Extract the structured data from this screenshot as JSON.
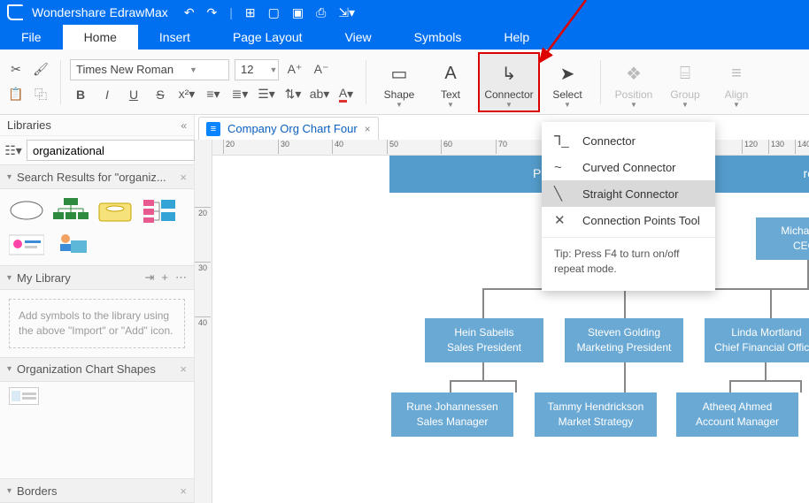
{
  "app": {
    "title": "Wondershare EdrawMax"
  },
  "menu": {
    "file": "File",
    "home": "Home",
    "insert": "Insert",
    "page_layout": "Page Layout",
    "view": "View",
    "symbols": "Symbols",
    "help": "Help"
  },
  "ribbon": {
    "font": "Times New Roman",
    "size": "12",
    "shape": "Shape",
    "text": "Text",
    "connector": "Connector",
    "select": "Select",
    "position": "Position",
    "group": "Group",
    "align": "Align"
  },
  "sidebar": {
    "title": "Libraries",
    "search_value": "organizational",
    "panel_results": "Search Results for  \"organiz...",
    "panel_mylib": "My Library",
    "hint": "Add symbols to the library using the above \"Import\" or \"Add\" icon.",
    "panel_org": "Organization Chart Shapes",
    "panel_borders": "Borders"
  },
  "tab": {
    "name": "Company Org Chart Four"
  },
  "ruler_h": [
    "20",
    "30",
    "40",
    "50",
    "60",
    "70",
    "120",
    "130",
    "140"
  ],
  "ruler_v": [
    "20",
    "30",
    "40"
  ],
  "dropdown": {
    "connector": "Connector",
    "curved": "Curved Connector",
    "straight": "Straight Connector",
    "points": "Connection Points Tool",
    "tip": "Tip: Press F4 to turn on/off repeat mode."
  },
  "org": {
    "purch": "Purch",
    "re_suffix": "re",
    "ceo_name": "Michael D",
    "ceo_role": "CEO",
    "p1_name": "Hein Sabelis",
    "p1_role": "Sales President",
    "p2_name": "Steven Golding",
    "p2_role": "Marketing President",
    "p3_name": "Linda Mortland",
    "p3_role": "Chief Financial Officer",
    "m1_name": "Rune Johannessen",
    "m1_role": "Sales Manager",
    "m2_name": "Tammy Hendrickson",
    "m2_role": "Market Strategy",
    "m3_name": "Atheeq Ahmed",
    "m3_role": "Account Manager"
  }
}
